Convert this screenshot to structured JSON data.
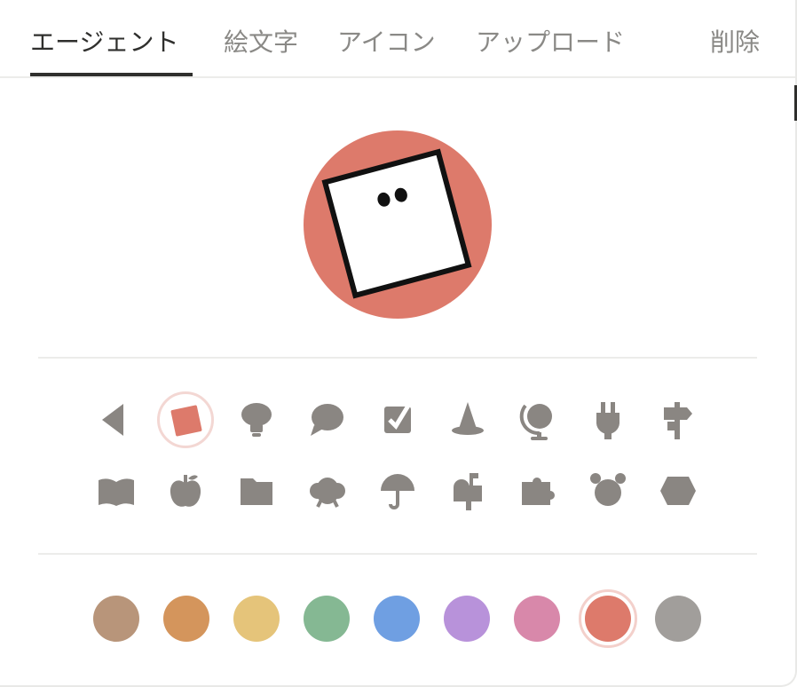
{
  "tabs": [
    {
      "label": "エージェント",
      "active": true
    },
    {
      "label": "絵文字",
      "active": false
    },
    {
      "label": "アイコン",
      "active": false
    },
    {
      "label": "アップロード",
      "active": false
    }
  ],
  "remove_label": "削除",
  "preview": {
    "background_color": "#dd7a6b",
    "icon": "robot-square-icon"
  },
  "icons_row1": [
    "triangle-icon",
    "square-icon",
    "lightbulb-icon",
    "speech-bubble-icon",
    "checkbox-icon",
    "witch-hat-icon",
    "globe-icon",
    "plug-icon",
    "signpost-icon"
  ],
  "icons_row2": [
    "book-icon",
    "apple-icon",
    "folder-icon",
    "cloud-icon",
    "umbrella-icon",
    "mailbox-icon",
    "puzzle-icon",
    "alarm-clock-icon",
    "hexagon-icon"
  ],
  "selected_icon": "square-icon",
  "colors": [
    "#b8957a",
    "#d4955c",
    "#e5c47a",
    "#85b893",
    "#6f9fe2",
    "#b892da",
    "#d888aa",
    "#dd7a6b",
    "#a19e9b"
  ],
  "selected_color": "#dd7a6b"
}
